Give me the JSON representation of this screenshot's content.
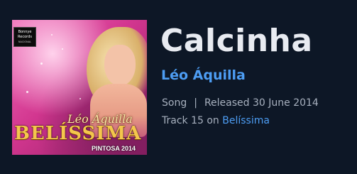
{
  "song": {
    "title": "Calcinha",
    "artist": "Léo Áquilla",
    "type": "Song",
    "separator": "|",
    "released_prefix": "Released",
    "released_date": "30 June 2014",
    "track_prefix": "Track 15 on",
    "album": "Belíssima"
  },
  "cover": {
    "logo_line1": "Bonnye",
    "logo_line2": "Records",
    "logo_line3": "NACIONAL",
    "artist_script": "Léo Áquilla",
    "album_title": "BELÍSSIMA",
    "edition": "PINTOSA 2014"
  },
  "colors": {
    "background": "#0d1726",
    "accent": "#4d9df3",
    "title_text": "#e8ebf1",
    "meta_text": "#a7b0be"
  }
}
